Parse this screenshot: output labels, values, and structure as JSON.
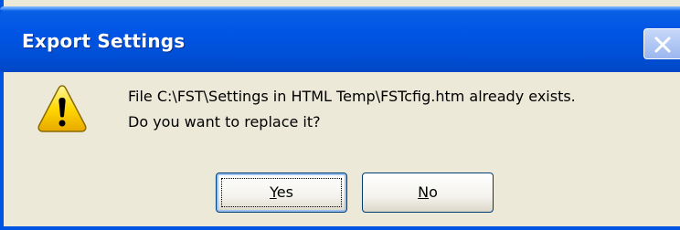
{
  "window": {
    "title": "Export Settings",
    "colors": {
      "titlebar": "#0055e5",
      "frame": "#0054e3",
      "body": "#ece9d8"
    }
  },
  "message": {
    "line1": "File C:\\FST\\Settings in HTML Temp\\FSTcfig.htm already exists.",
    "line2": "Do you want to replace it?",
    "icon": "warning-icon"
  },
  "buttons": {
    "yes": {
      "mnemonic": "Y",
      "rest": "es"
    },
    "no": {
      "mnemonic": "N",
      "rest": "o"
    }
  },
  "titlebar_controls": {
    "close_icon": "close-icon"
  }
}
